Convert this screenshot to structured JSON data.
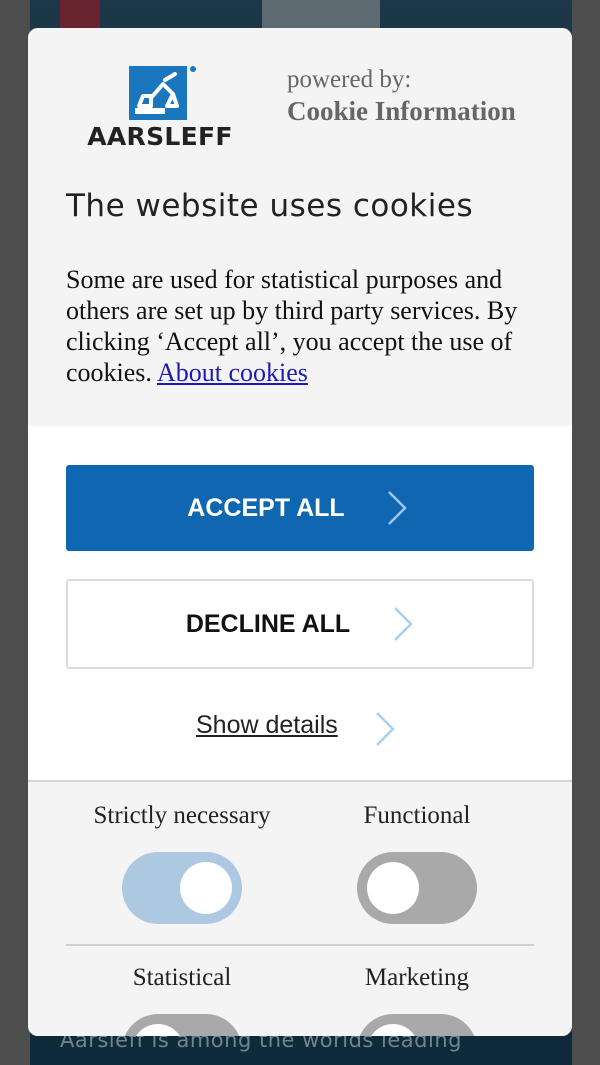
{
  "brand": {
    "logo_text": "AARSLEFF",
    "powered_by": "powered by:",
    "provider": "Cookie Information",
    "accent_color": "#0f67b1"
  },
  "banner": {
    "title": "The website uses cookies",
    "description": "Some are used for statistical purposes and others are set up by third party services. By clicking ‘Accept all’, you accept the use of cookies. ",
    "about_link": "About cookies"
  },
  "buttons": {
    "accept_all": "ACCEPT ALL",
    "decline_all": "DECLINE ALL",
    "show_details": "Show details"
  },
  "categories": [
    {
      "label": "Strictly necessary",
      "enabled": true,
      "locked": true
    },
    {
      "label": "Functional",
      "enabled": false
    },
    {
      "label": "Statistical",
      "enabled": false
    },
    {
      "label": "Marketing",
      "enabled": false
    }
  ],
  "background": {
    "text": "Aarsleff is among the worlds leading"
  }
}
